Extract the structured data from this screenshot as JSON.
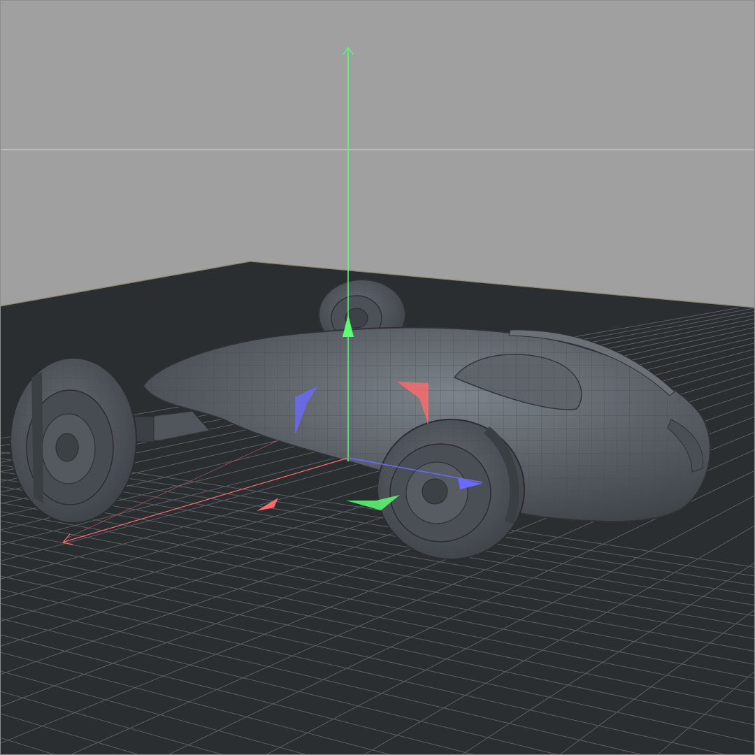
{
  "viewport": {
    "sky_color": "#a0a0a0",
    "horizon_line_color": "#c6c6c6",
    "floor_color": "#2b2e31",
    "grid_color": "#5a5f63",
    "floor_edge_color": "#d6c98a"
  },
  "model": {
    "body_color": "#565c62",
    "body_highlight": "#7a8086",
    "wire_color": "#3f4449",
    "tire_color": "#4a4f55",
    "tire_dark": "#3a3e43"
  },
  "gizmo": {
    "x_axis_color": "#ff6a6a",
    "y_axis_color": "#5cff72",
    "z_axis_color": "#6a6aff"
  }
}
